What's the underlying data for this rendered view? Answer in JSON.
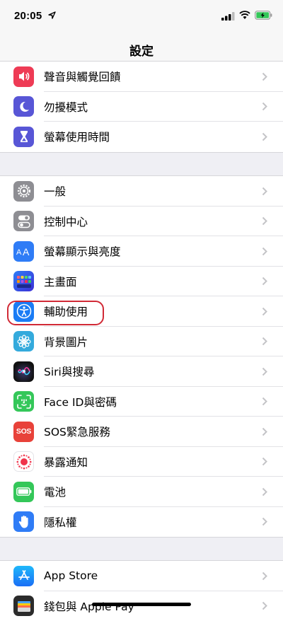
{
  "status_bar": {
    "time": "20:05"
  },
  "nav": {
    "title": "設定"
  },
  "groups": [
    {
      "items": [
        {
          "label": "聲音與觸覺回饋",
          "icon": "speaker-icon",
          "color": "#ee3b55"
        },
        {
          "label": "勿擾模式",
          "icon": "moon-icon",
          "color": "#5856d6"
        },
        {
          "label": "螢幕使用時間",
          "icon": "hourglass-icon",
          "color": "#5856d6"
        }
      ]
    },
    {
      "items": [
        {
          "label": "一般",
          "icon": "gear-icon",
          "color": "#8e8e93"
        },
        {
          "label": "控制中心",
          "icon": "toggles-icon",
          "color": "#8e8e93"
        },
        {
          "label": "螢幕顯示與亮度",
          "icon": "text-size-icon",
          "color": "#2f7cf6"
        },
        {
          "label": "主畫面",
          "icon": "home-grid-icon",
          "color": "#2f5df2"
        },
        {
          "label": "輔助使用",
          "icon": "accessibility-icon",
          "color": "#1a7cf5"
        },
        {
          "label": "背景圖片",
          "icon": "flower-icon",
          "color": "#34aadc"
        },
        {
          "label": "Siri與搜尋",
          "icon": "siri-icon",
          "color": "#1a1a2e"
        },
        {
          "label": "Face ID與密碼",
          "icon": "face-id-icon",
          "color": "#34c759"
        },
        {
          "label": "SOS緊急服務",
          "icon": "sos-icon",
          "color": "#e8423a",
          "icon_text": "SOS"
        },
        {
          "label": "暴露通知",
          "icon": "exposure-icon",
          "color": "#ffffff"
        },
        {
          "label": "電池",
          "icon": "battery-app-icon",
          "color": "#34c759"
        },
        {
          "label": "隱私權",
          "icon": "hand-icon",
          "color": "#2f7cf6"
        }
      ]
    },
    {
      "items": [
        {
          "label": "App Store",
          "icon": "app-store-icon",
          "color": "#1a8cf5"
        },
        {
          "label": "錢包與 Apple Pay",
          "icon": "wallet-icon",
          "color": "#2b2b2b"
        }
      ]
    }
  ],
  "highlight_target": "輔助使用"
}
